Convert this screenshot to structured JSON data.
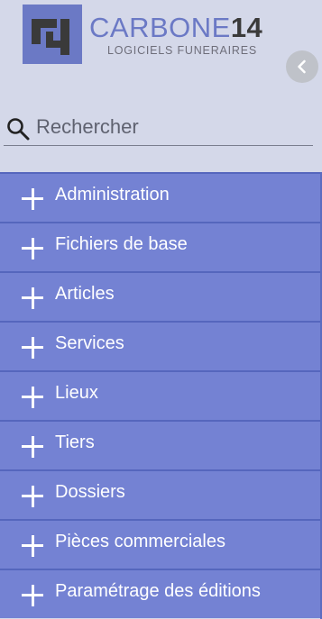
{
  "brand": {
    "name_letters": "CARBONE",
    "name_number": "14",
    "tagline": "LOGICIELS FUNERAIRES"
  },
  "search": {
    "placeholder": "Rechercher"
  },
  "menu": {
    "items": [
      {
        "label": "Administration"
      },
      {
        "label": "Fichiers de base"
      },
      {
        "label": "Articles"
      },
      {
        "label": "Services"
      },
      {
        "label": "Lieux"
      },
      {
        "label": "Tiers"
      },
      {
        "label": "Dossiers"
      },
      {
        "label": "Pièces commerciales"
      },
      {
        "label": "Paramétrage des éditions"
      }
    ]
  },
  "colors": {
    "menu_bg": "#7482d3",
    "menu_border": "#5566bd",
    "header_bg": "#d4d8e9",
    "brand_accent": "#6b79c5"
  },
  "icons": {
    "logo": "carbone14-logo-icon",
    "collapse": "chevron-left-icon",
    "search": "search-icon",
    "expand": "plus-icon"
  }
}
